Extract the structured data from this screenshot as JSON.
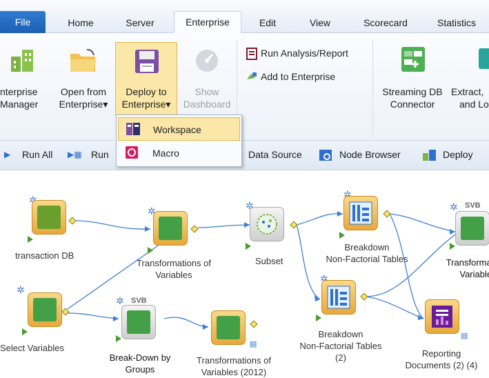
{
  "tabs": [
    "File",
    "Home",
    "Server",
    "Enterprise",
    "Edit",
    "View",
    "Scorecard",
    "Statistics"
  ],
  "ribbon": {
    "enterprise_manager": [
      "nterprise",
      "Manager"
    ],
    "open_from_enterprise": [
      "Open from",
      "Enterprise▾"
    ],
    "deploy_to_enterprise": [
      "Deploy to",
      "Enterprise▾"
    ],
    "show_dashboard": [
      "Show",
      "Dashboard"
    ],
    "run_analysis": "Run Analysis/Report",
    "add_to_enterprise": "Add to Enterprise",
    "streaming_db": [
      "Streaming DB",
      "Connector"
    ],
    "extract": [
      "Extract,",
      "and Lo"
    ]
  },
  "dropdown": {
    "items": [
      "Workspace",
      "Macro"
    ]
  },
  "toolbar": {
    "run_all": "Run All",
    "run": "Run",
    "data_source": "Data Source",
    "node_browser": "Node Browser",
    "deploy": "Deploy"
  },
  "nodes": {
    "transaction_db": "transaction DB",
    "transformations": [
      "Transformations of",
      "Variables"
    ],
    "subset": "Subset",
    "breakdown1": [
      "Breakdown",
      "Non-Factorial Tables"
    ],
    "transformations_right": [
      "Transformati",
      "Variables"
    ],
    "svb_right": "SVB",
    "select_variables": "Select Variables",
    "svb_mid": "SVB",
    "breakdown_groups": [
      "Break-Down by",
      "Groups"
    ],
    "transformations_2012": [
      "Transformations of",
      "Variables (2012)"
    ],
    "breakdown2": [
      "Breakdown",
      "Non-Factorial Tables",
      "(2)"
    ],
    "reporting": [
      "Reporting",
      "Documents (2) (4)"
    ]
  },
  "colors": {
    "accent_blue": "#1d5fb3",
    "highlight": "#fbe7a8",
    "node_orange": "#e7a93b",
    "link_blue": "#3d7fd6"
  }
}
